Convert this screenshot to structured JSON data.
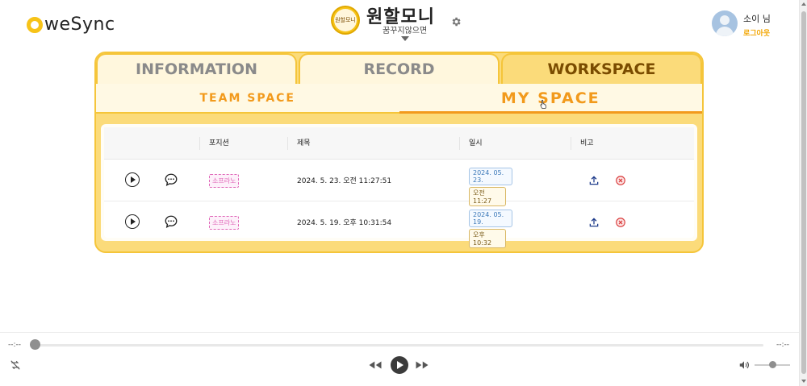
{
  "app": {
    "logo_text": "weSync"
  },
  "group": {
    "name": "원할모니",
    "subtitle": "꿈꾸지않으면",
    "avatar_text": "원할모니"
  },
  "user": {
    "name": "소이 님",
    "logout_label": "로그아웃"
  },
  "tabs": [
    {
      "label": "INFORMATION",
      "active": false
    },
    {
      "label": "RECORD",
      "active": false
    },
    {
      "label": "WORKSPACE",
      "active": true
    }
  ],
  "subtabs": [
    {
      "label": "TEAM SPACE",
      "active": false
    },
    {
      "label": "MY SPACE",
      "active": true
    }
  ],
  "table": {
    "headers": {
      "position": "포지션",
      "title": "제목",
      "datetime": "일시",
      "note": "비고"
    },
    "rows": [
      {
        "position": "소프라노",
        "title": "2024. 5. 23. 오전 11:27:51",
        "date": "2024. 05. 23.",
        "time": "오전 11:27"
      },
      {
        "position": "소프라노",
        "title": "2024. 5. 19. 오후 10:31:54",
        "date": "2024. 05. 19.",
        "time": "오후 10:32"
      }
    ]
  },
  "player": {
    "time_current": "--:--",
    "time_total": "--:--",
    "progress": 0,
    "volume": 0.5
  },
  "colors": {
    "accent": "#f7c318",
    "panel": "#fbdb7a",
    "subtab_text": "#f29a1c",
    "active_tab_text": "#7a4c00",
    "tag_pink": "#e067b8",
    "delete_red": "#d93b3b"
  }
}
